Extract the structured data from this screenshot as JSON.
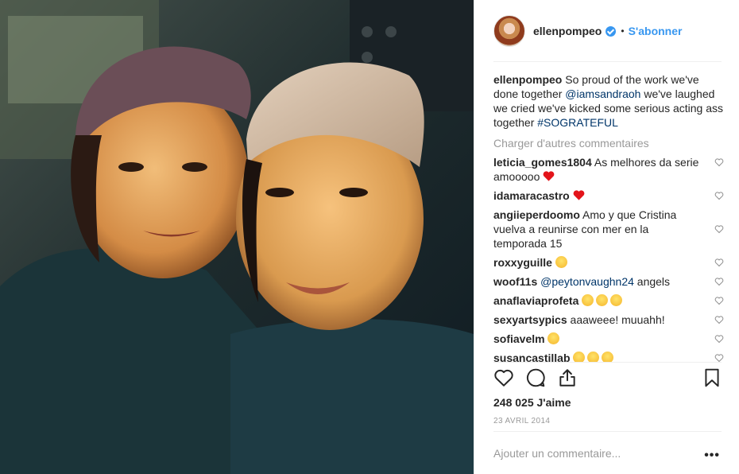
{
  "post": {
    "header": {
      "username": "ellenpompeo",
      "separator": "•",
      "follow_label": "S'abonner"
    },
    "caption": {
      "username": "ellenpompeo",
      "text_1": "So proud of the work we've done together ",
      "mention": "@iamsandraoh",
      "text_2": " we've laughed we cried we've kicked some serious acting ass together ",
      "hashtag": "#SOGRATEFUL"
    },
    "load_more_label": "Charger d'autres commentaires",
    "comments": [
      {
        "user": "leticia_gomes1804",
        "text": "As melhores da serie amooooo",
        "emoji": [
          "red-heart"
        ]
      },
      {
        "user": "idamaracastro",
        "text": "",
        "emoji": [
          "red-heart"
        ]
      },
      {
        "user": "angiieperdoomo",
        "text": "Amo y que Cristina vuelva a reunirse con mer en la temporada 15",
        "emoji": []
      },
      {
        "user": "roxxyguille",
        "text": "",
        "emoji": [
          "kissing-face"
        ]
      },
      {
        "user": "woof11s",
        "mention": "@peytonvaughn24",
        "text": " angels",
        "emoji": []
      },
      {
        "user": "anaflaviaprofeta",
        "text": "",
        "emoji": [
          "heart-eyes",
          "heart-eyes",
          "heart-eyes"
        ]
      },
      {
        "user": "sexyartsypics",
        "text": "aaaweee! muuahh!",
        "emoji": []
      },
      {
        "user": "sofiavelm",
        "text": "",
        "emoji": [
          "crying-face"
        ]
      },
      {
        "user": "susancastillab",
        "text": "",
        "emoji": [
          "sad-face",
          "sad-face",
          "sad-face"
        ]
      }
    ],
    "likes_label": "248 025 J'aime",
    "date_label": "23 AVRIL 2014",
    "add_comment_placeholder": "Ajouter un commentaire...",
    "more_label": "•••"
  },
  "icons": {
    "like": "heart-outline-icon",
    "comment": "comment-icon",
    "share": "share-icon",
    "save": "bookmark-icon"
  },
  "colors": {
    "link": "#003569",
    "follow": "#3897f0",
    "muted": "#999999",
    "heart": "#ed4956"
  }
}
